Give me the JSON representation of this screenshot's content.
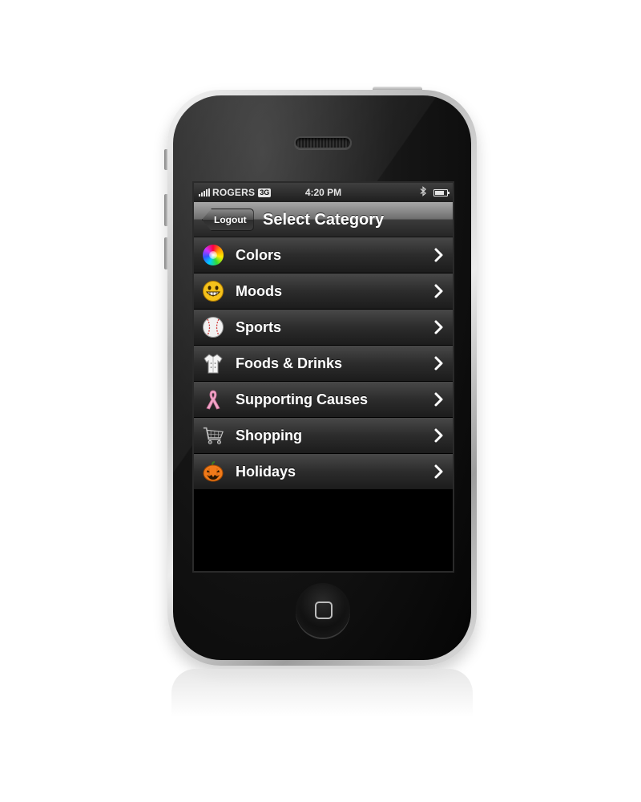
{
  "status_bar": {
    "carrier": "ROGERS",
    "network": "3G",
    "time": "4:20 PM",
    "battery_level_percent": 80
  },
  "nav_bar": {
    "back_label": "Logout",
    "title": "Select Category"
  },
  "categories": [
    {
      "label": "Colors",
      "icon": "color-wheel-icon"
    },
    {
      "label": "Moods",
      "icon": "grinning-smiley-icon"
    },
    {
      "label": "Sports",
      "icon": "baseball-icon"
    },
    {
      "label": "Foods & Drinks",
      "icon": "chef-jacket-icon"
    },
    {
      "label": "Supporting Causes",
      "icon": "awareness-ribbon-icon"
    },
    {
      "label": "Shopping",
      "icon": "shopping-cart-icon"
    },
    {
      "label": "Holidays",
      "icon": "jack-o-lantern-icon"
    }
  ],
  "colors": {
    "list_text": "#ffffff",
    "ribbon": "#f2a7c9",
    "pumpkin": "#f07a1a",
    "smiley": "#f5c21b"
  }
}
